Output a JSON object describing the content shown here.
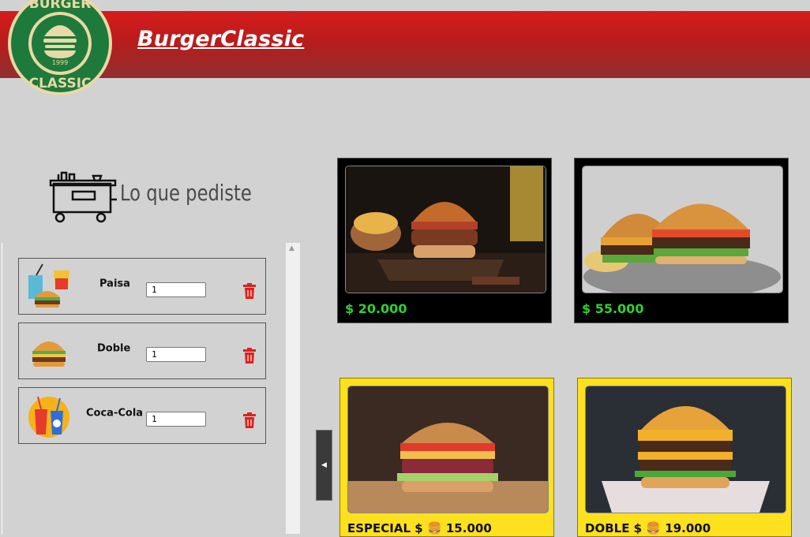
{
  "header": {
    "brand": "BurgerClassic",
    "logo": {
      "top": "BURGER",
      "year": "1999",
      "bottom": "CLASSIC"
    }
  },
  "cart": {
    "title": "Lo que pediste",
    "items": [
      {
        "name": "Paisa",
        "quantity": "1",
        "icon": "combo-meal-icon"
      },
      {
        "name": "Doble",
        "quantity": "1",
        "icon": "burger-icon"
      },
      {
        "name": "Coca-Cola",
        "quantity": "1",
        "icon": "soda-icon"
      }
    ]
  },
  "products": [
    {
      "price": "$ 20.000"
    },
    {
      "price": "$ 55.000"
    },
    {
      "label": "ESPECIAL $",
      "emoji": "🍔",
      "price": "15.000"
    },
    {
      "label": "DOBLE $",
      "emoji": "🍔",
      "price": "19.000"
    }
  ],
  "colors": {
    "header_red": "#c81e1e",
    "price_green": "#2fd12f",
    "card_yellow": "#fde01e",
    "trash_red": "#e0201c",
    "logo_green": "#1e7a3a"
  }
}
